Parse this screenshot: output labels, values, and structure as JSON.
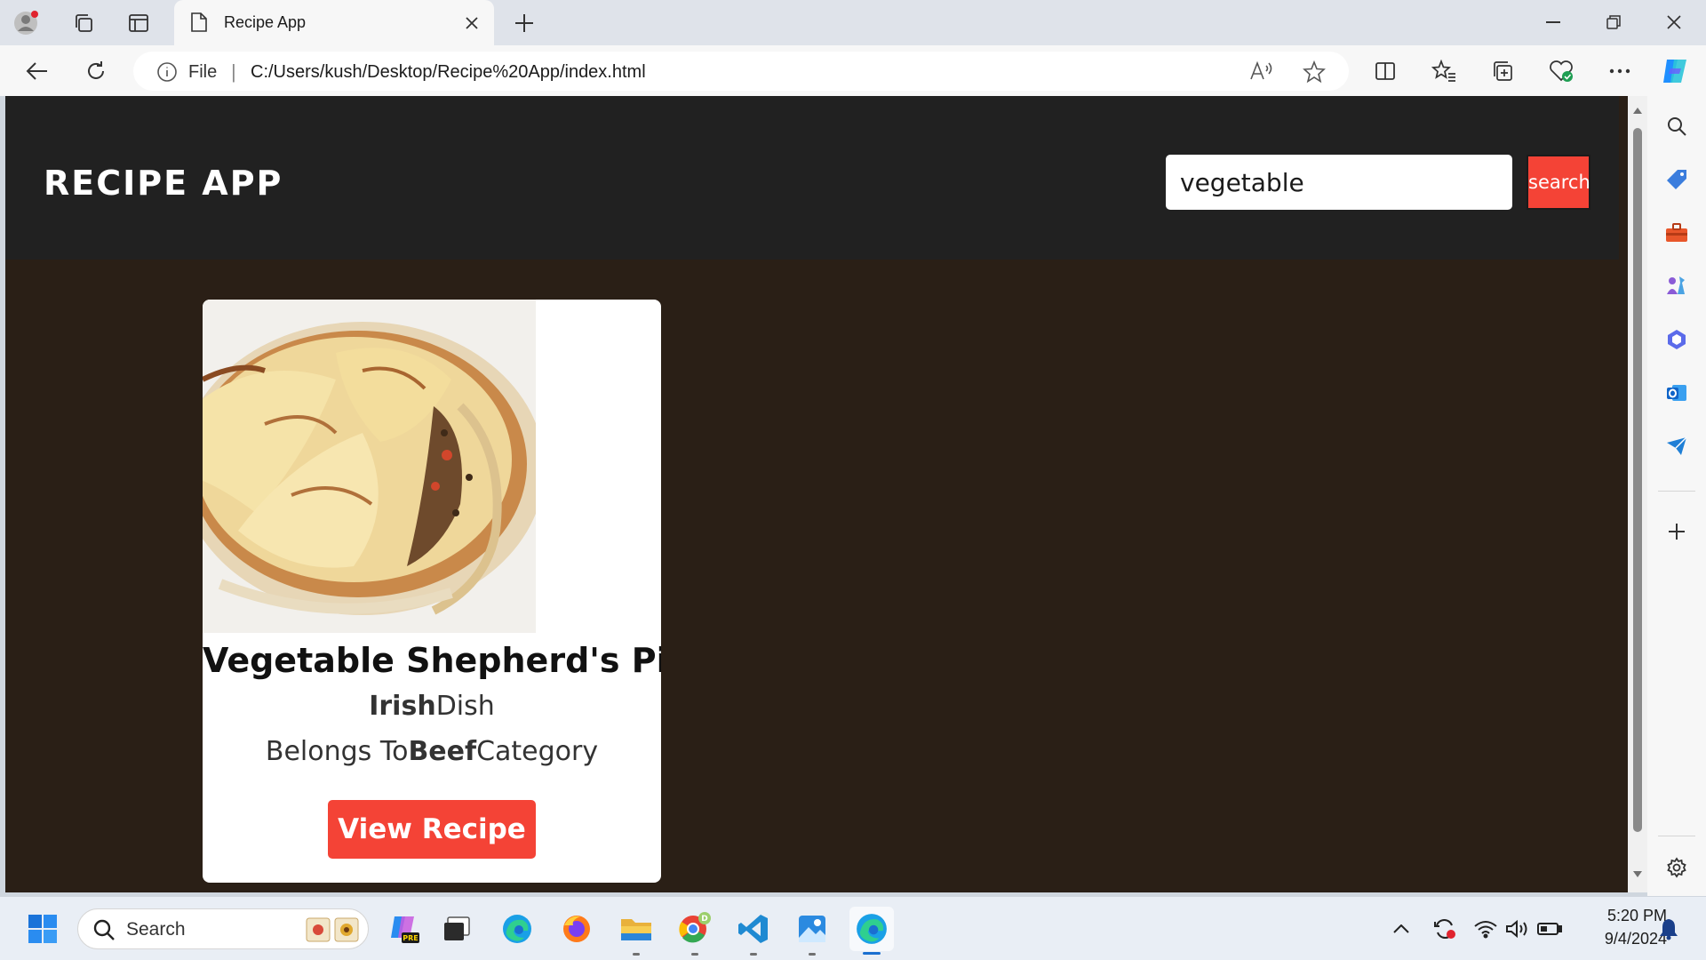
{
  "browser": {
    "tab_title": "Recipe App",
    "address_scheme_label": "File",
    "address_url": "C:/Users/kush/Desktop/Recipe%20App/index.html"
  },
  "app": {
    "title": "RECIPE APP",
    "search_value": "vegetable",
    "search_button_label": "search",
    "accent_color": "#f44336",
    "header_color": "#212121",
    "background_color": "#2a1f16"
  },
  "recipe_card": {
    "name": "Vegetable Shepherd's Pie",
    "area": "Irish",
    "area_suffix": "Dish",
    "category_prefix": "Belongs To",
    "category": "Beef",
    "category_suffix": "Category",
    "button_label": "View Recipe"
  },
  "taskbar": {
    "search_label": "Search",
    "time": "5:20 PM",
    "date": "9/4/2024"
  }
}
